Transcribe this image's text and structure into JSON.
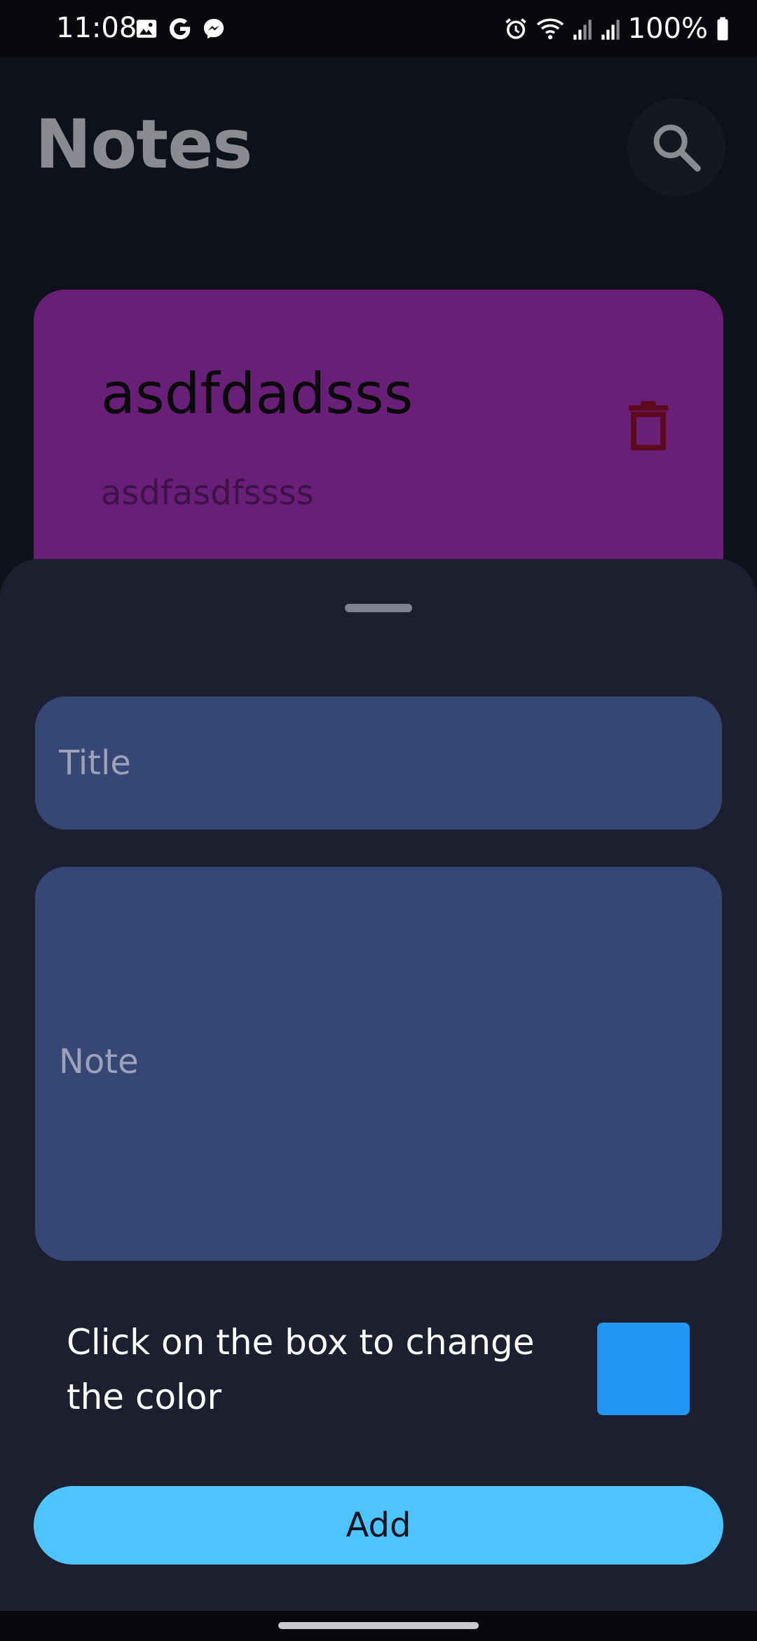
{
  "status_bar": {
    "time": "11:08",
    "battery": "100%",
    "notification_icons": [
      "gallery-icon",
      "google-icon",
      "messenger-icon"
    ],
    "system_icons": [
      "alarm-icon",
      "wifi-icon",
      "signal-icon",
      "signal-icon",
      "battery-icon"
    ]
  },
  "header": {
    "title": "Notes",
    "search_icon": "search-icon"
  },
  "notes": [
    {
      "title": "asdfdadsss",
      "body": "asdfasdfssss",
      "color": "#691f77",
      "delete_icon": "trash-icon",
      "delete_icon_color": "#5c0a1c"
    }
  ],
  "sheet": {
    "title_placeholder": "Title",
    "title_value": "",
    "note_placeholder": "Note",
    "note_value": "",
    "color_hint": "Click on the box to change the color",
    "selected_color": "#2196f3",
    "add_label": "Add",
    "add_color": "#4ec4ff"
  }
}
